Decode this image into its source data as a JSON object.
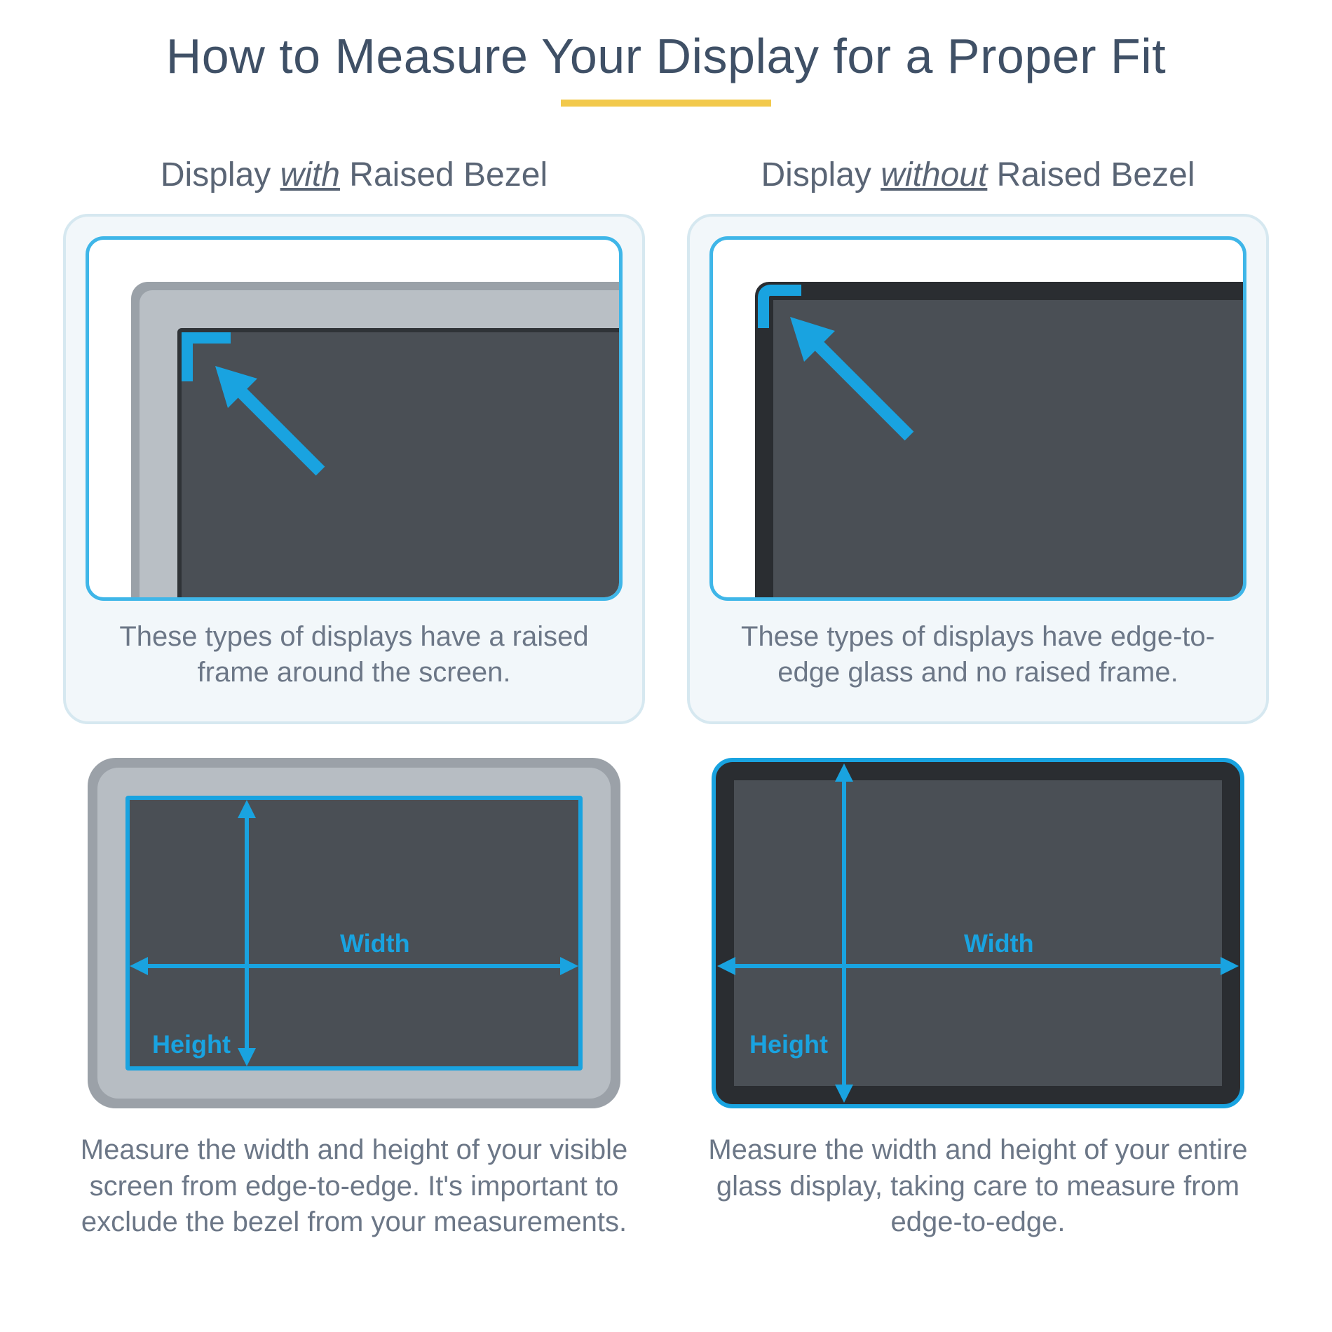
{
  "title": "How to Measure Your Display for a Proper Fit",
  "left": {
    "heading_pre": "Display ",
    "heading_em": "with",
    "heading_post": " Raised Bezel",
    "top_desc": "These types of displays have a raised frame around the screen.",
    "width_label": "Width",
    "height_label": "Height",
    "bottom_desc": "Measure the width and height of your visible screen from edge-to-edge. It's important to exclude the bezel from your measurements."
  },
  "right": {
    "heading_pre": "Display ",
    "heading_em": "without",
    "heading_post": " Raised Bezel",
    "top_desc": "These types of displays have edge-to-edge glass and no raised frame.",
    "width_label": "Width",
    "height_label": "Height",
    "bottom_desc": "Measure the width and height of your entire glass display, taking care to measure from edge-to-edge."
  },
  "colors": {
    "accent_blue": "#19a3e0",
    "underline_yellow": "#f2c94c"
  }
}
